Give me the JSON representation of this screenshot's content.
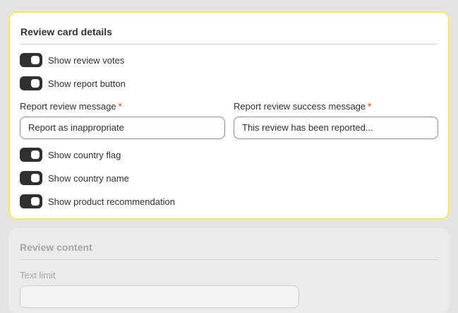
{
  "review_card": {
    "title": "Review card details",
    "toggles": {
      "show_review_votes": {
        "label": "Show review votes",
        "on": true
      },
      "show_report_button": {
        "label": "Show report button",
        "on": true
      },
      "show_country_flag": {
        "label": "Show country flag",
        "on": true
      },
      "show_country_name": {
        "label": "Show country name",
        "on": true
      },
      "show_product_recommendation": {
        "label": "Show product recommendation",
        "on": true
      }
    },
    "report_message": {
      "label": "Report review message",
      "required_mark": "*",
      "value": "Report as inappropriate"
    },
    "success_message": {
      "label": "Report review success message",
      "required_mark": "*",
      "value": "This review has been reported..."
    }
  },
  "review_content": {
    "title": "Review content",
    "text_limit": {
      "label": "Text limit",
      "value": ""
    }
  },
  "colors": {
    "accent_border": "#f0e27a",
    "toggle_on": "#303030",
    "required": "#c5280c"
  }
}
